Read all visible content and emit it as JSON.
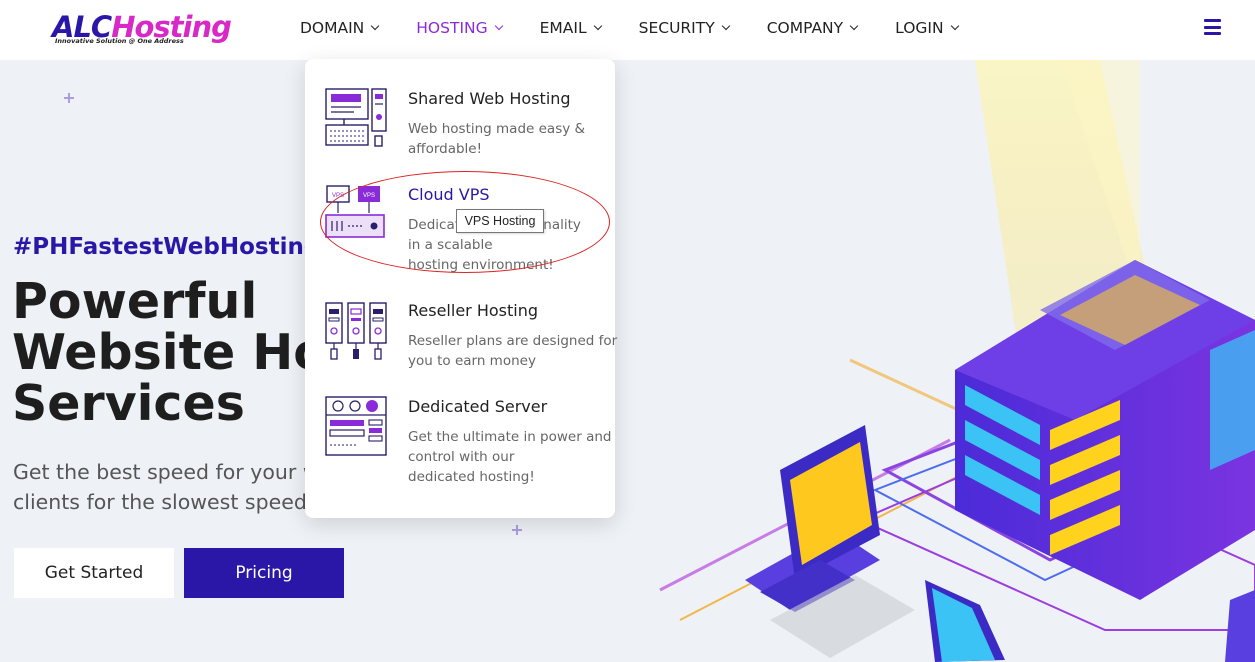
{
  "brand": {
    "logo_main": "ALC",
    "logo_accent": "Hosting",
    "logo_tagline": "Innovative Solution @ One Address"
  },
  "nav": {
    "items": [
      {
        "label": "DOMAIN",
        "active": false
      },
      {
        "label": "HOSTING",
        "active": true
      },
      {
        "label": "EMAIL",
        "active": false
      },
      {
        "label": "SECURITY",
        "active": false
      },
      {
        "label": "COMPANY",
        "active": false
      },
      {
        "label": "LOGIN",
        "active": false
      }
    ],
    "menu_icon": "hamburger-icon"
  },
  "hero": {
    "hashtag": "#PHFastestWebHosting",
    "title_lines": [
      "Powerful",
      "Website Ho",
      "Services"
    ],
    "subtitle_lines": [
      "Get the best speed for your w",
      "clients for the slowest speed o"
    ],
    "cta_primary": "Get Started",
    "cta_secondary": "Pricing"
  },
  "hosting_menu": {
    "items": [
      {
        "title": "Shared Web Hosting",
        "desc_lines": [
          "Web hosting made easy &",
          "affordable!"
        ],
        "icon": "shared-hosting-icon"
      },
      {
        "title": "Cloud VPS",
        "desc_lines": [
          "Dedicat",
          "in a scalable",
          "hosting environment!"
        ],
        "desc_tail": "nctionality",
        "icon": "cloud-vps-icon",
        "highlighted": true
      },
      {
        "title": "Reseller Hosting",
        "desc_lines": [
          "Reseller plans are designed for",
          "you to earn money"
        ],
        "icon": "reseller-hosting-icon"
      },
      {
        "title": "Dedicated Server",
        "desc_lines": [
          "Get the ultimate in power and",
          "control with our",
          "dedicated hosting!"
        ],
        "icon": "dedicated-server-icon"
      }
    ],
    "tooltip": "VPS Hosting"
  },
  "colors": {
    "brand_blue": "#2a17a8",
    "accent_purple": "#8a2bd8",
    "logo_pink": "#d928c8",
    "annotation_red": "#dd2222"
  }
}
